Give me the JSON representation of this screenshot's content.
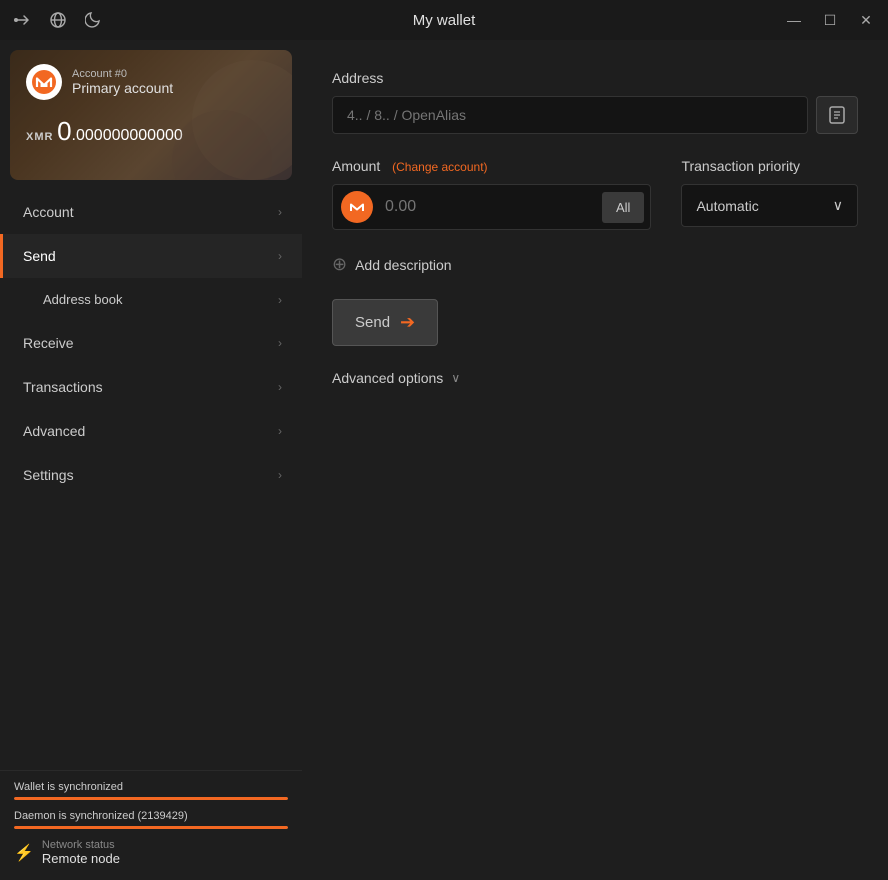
{
  "titlebar": {
    "title": "My wallet",
    "icons": {
      "transfer": "⇒",
      "globe": "🌐",
      "moon": "☾"
    },
    "controls": {
      "minimize": "—",
      "maximize": "☐",
      "close": "✕"
    }
  },
  "sidebar": {
    "account": {
      "number": "Account #0",
      "name": "Primary account",
      "currency": "XMR",
      "balance_whole": "0",
      "balance_decimal": ".000000000000"
    },
    "nav_items": [
      {
        "id": "account",
        "label": "Account",
        "active": false,
        "sub": false
      },
      {
        "id": "send",
        "label": "Send",
        "active": true,
        "sub": false
      },
      {
        "id": "address-book",
        "label": "Address book",
        "active": false,
        "sub": true
      },
      {
        "id": "receive",
        "label": "Receive",
        "active": false,
        "sub": false
      },
      {
        "id": "transactions",
        "label": "Transactions",
        "active": false,
        "sub": false
      },
      {
        "id": "advanced",
        "label": "Advanced",
        "active": false,
        "sub": false
      },
      {
        "id": "settings",
        "label": "Settings",
        "active": false,
        "sub": false
      }
    ],
    "status": {
      "wallet_sync": "Wallet is synchronized",
      "wallet_sync_pct": 100,
      "daemon_sync": "Daemon is synchronized (2139429)",
      "daemon_sync_pct": 100,
      "network_label": "Network status",
      "network_value": "Remote node"
    }
  },
  "content": {
    "address_label": "Address",
    "address_placeholder": "4.. / 8.. / OpenAlias",
    "amount_label": "Amount",
    "amount_change": "(Change account)",
    "amount_placeholder": "0.00",
    "all_button": "All",
    "priority_label": "Transaction priority",
    "priority_value": "Automatic",
    "add_description": "Add description",
    "send_button": "Send",
    "advanced_options": "Advanced options"
  }
}
